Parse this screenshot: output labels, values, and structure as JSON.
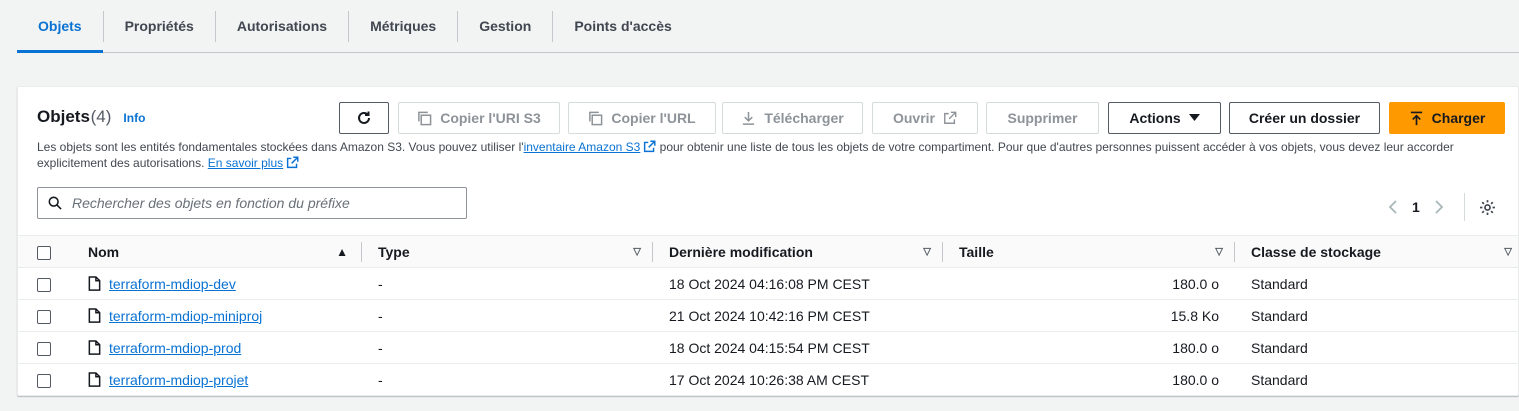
{
  "tabs": [
    {
      "label": "Objets",
      "active": true
    },
    {
      "label": "Propriétés"
    },
    {
      "label": "Autorisations"
    },
    {
      "label": "Métriques"
    },
    {
      "label": "Gestion"
    },
    {
      "label": "Points d'accès"
    }
  ],
  "panel": {
    "title": "Objets",
    "count": "(4)",
    "info": "Info",
    "desc_pre": "Les objets sont les entités fondamentales stockées dans Amazon S3. Vous pouvez utiliser l'",
    "desc_link": "inventaire Amazon S3",
    "desc_post": " pour obtenir une liste de tous les objets de votre compartiment. Pour que d'autres personnes puissent accéder à vos objets, vous devez leur accorder explicitement des autorisations. ",
    "learn_more": "En savoir plus"
  },
  "toolbar": {
    "copy_uri": "Copier l'URI S3",
    "copy_url": "Copier l'URL",
    "download": "Télécharger",
    "open": "Ouvrir",
    "delete": "Supprimer",
    "actions": "Actions",
    "create_folder": "Créer un dossier",
    "upload": "Charger"
  },
  "search": {
    "placeholder": "Rechercher des objets en fonction du préfixe"
  },
  "pagination": {
    "page": "1"
  },
  "columns": {
    "name": "Nom",
    "type": "Type",
    "modified": "Dernière modification",
    "size": "Taille",
    "storage": "Classe de stockage"
  },
  "rows": [
    {
      "name": "terraform-mdiop-dev",
      "type": "-",
      "modified": "18 Oct 2024 04:16:08 PM CEST",
      "size": "180.0 o",
      "storage": "Standard"
    },
    {
      "name": "terraform-mdiop-miniproj",
      "type": "-",
      "modified": "21 Oct 2024 10:42:16 PM CEST",
      "size": "15.8 Ko",
      "storage": "Standard"
    },
    {
      "name": "terraform-mdiop-prod",
      "type": "-",
      "modified": "18 Oct 2024 04:15:54 PM CEST",
      "size": "180.0 o",
      "storage": "Standard"
    },
    {
      "name": "terraform-mdiop-projet",
      "type": "-",
      "modified": "17 Oct 2024 10:26:38 AM CEST",
      "size": "180.0 o",
      "storage": "Standard"
    }
  ],
  "colors": {
    "accent": "#0972d3",
    "primary_button": "#ff9900"
  }
}
